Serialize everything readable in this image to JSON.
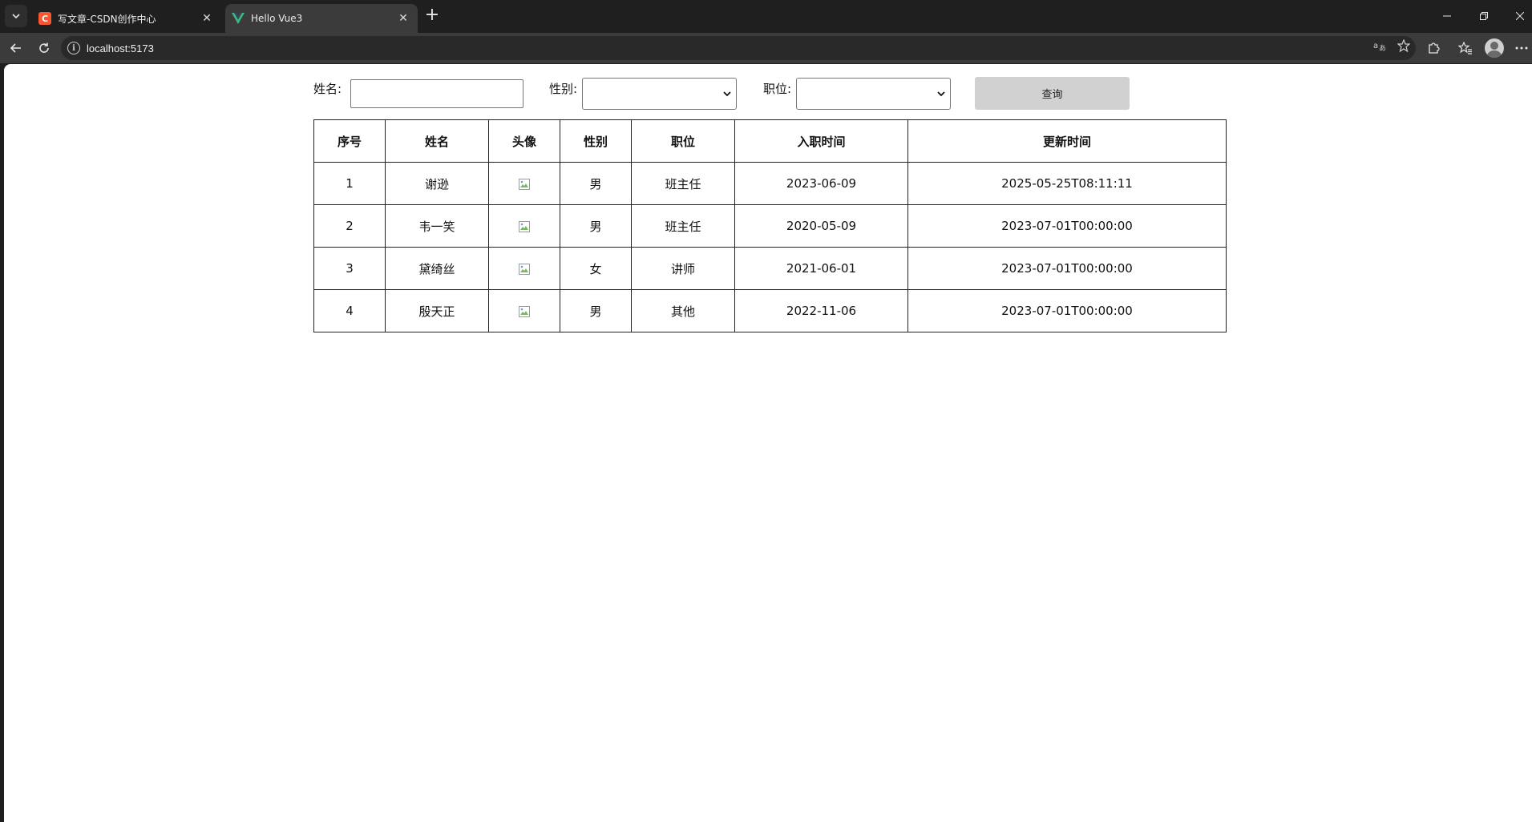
{
  "browser": {
    "tabs": [
      {
        "title": "写文章-CSDN创作中心",
        "icon": "csdn-icon",
        "active": false
      },
      {
        "title": "Hello Vue3",
        "icon": "vue-icon",
        "active": true
      }
    ],
    "url": "localhost:5173"
  },
  "search": {
    "name_label": "姓名:",
    "name_value": "",
    "gender_label": "性别:",
    "gender_value": "",
    "position_label": "职位:",
    "position_value": "",
    "query_label": "查询"
  },
  "table": {
    "headers": [
      "序号",
      "姓名",
      "头像",
      "性别",
      "职位",
      "入职时间",
      "更新时间"
    ],
    "rows": [
      {
        "id": "1",
        "name": "谢逊",
        "gender": "男",
        "job": "班主任",
        "entry": "2023-06-09",
        "updated": "2025-05-25T08:11:11"
      },
      {
        "id": "2",
        "name": "韦一笑",
        "gender": "男",
        "job": "班主任",
        "entry": "2020-05-09",
        "updated": "2023-07-01T00:00:00"
      },
      {
        "id": "3",
        "name": "黛绮丝",
        "gender": "女",
        "job": "讲师",
        "entry": "2021-06-01",
        "updated": "2023-07-01T00:00:00"
      },
      {
        "id": "4",
        "name": "殷天正",
        "gender": "男",
        "job": "其他",
        "entry": "2022-11-06",
        "updated": "2023-07-01T00:00:00"
      }
    ]
  }
}
